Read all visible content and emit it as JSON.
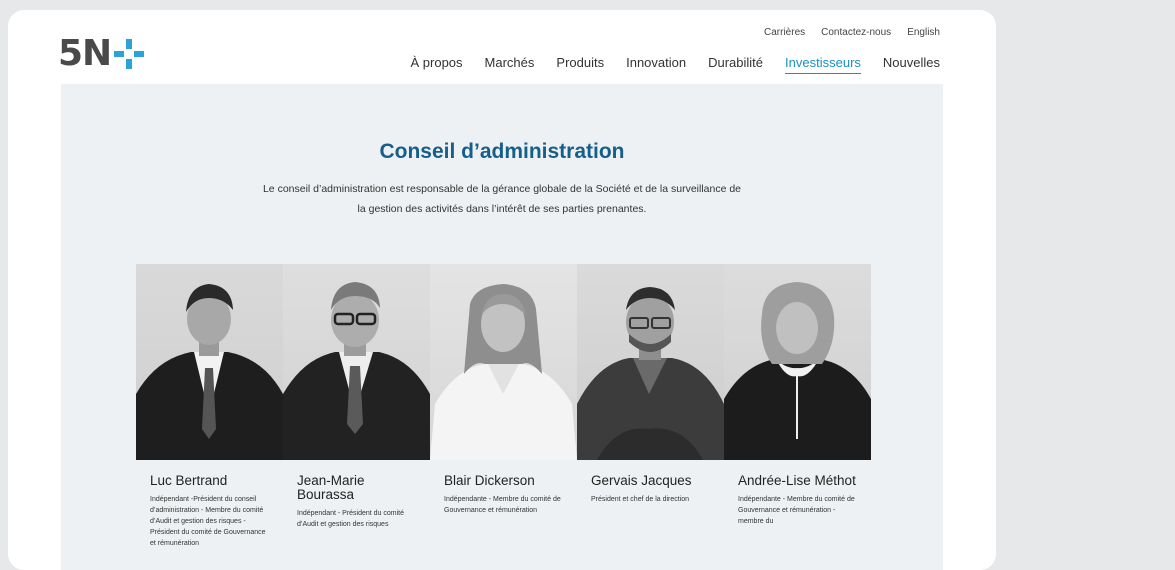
{
  "header": {
    "logo_text": "5N",
    "logo_plus_color": "#2ba3d9",
    "utility_links": [
      "Carrières",
      "Contactez-nous",
      "English"
    ],
    "nav": [
      "À propos",
      "Marchés",
      "Produits",
      "Innovation",
      "Durabilité",
      "Investisseurs",
      "Nouvelles"
    ],
    "active_nav": "Investisseurs"
  },
  "main": {
    "title": "Conseil d’administration",
    "intro": "Le conseil d’administration est responsable de la gérance globale de la Société et de la surveillance de la gestion des activités dans l’intérêt de ses parties prenantes."
  },
  "members": [
    {
      "name": "Luc Bertrand",
      "role": "Indépendant -Président du conseil d’administration - Membre du comité d’Audit et gestion des risques - Président du comité de Gouvernance et rémunération"
    },
    {
      "name": "Jean-Marie Bourassa",
      "role": "Indépendant - Président du comité d’Audit et gestion des risques"
    },
    {
      "name": "Blair Dickerson",
      "role": "Indépendante - Membre du comité de Gouvernance et rémunération"
    },
    {
      "name": "Gervais Jacques",
      "role": "Président et chef de la direction"
    },
    {
      "name": "Andrée-Lise Méthot",
      "role": "Indépendante - Membre du comité de Gouvernance et rémunération - membre du"
    }
  ],
  "colors": {
    "accent": "#1b8fc4",
    "title": "#165f8a",
    "background": "#eef1f3"
  }
}
